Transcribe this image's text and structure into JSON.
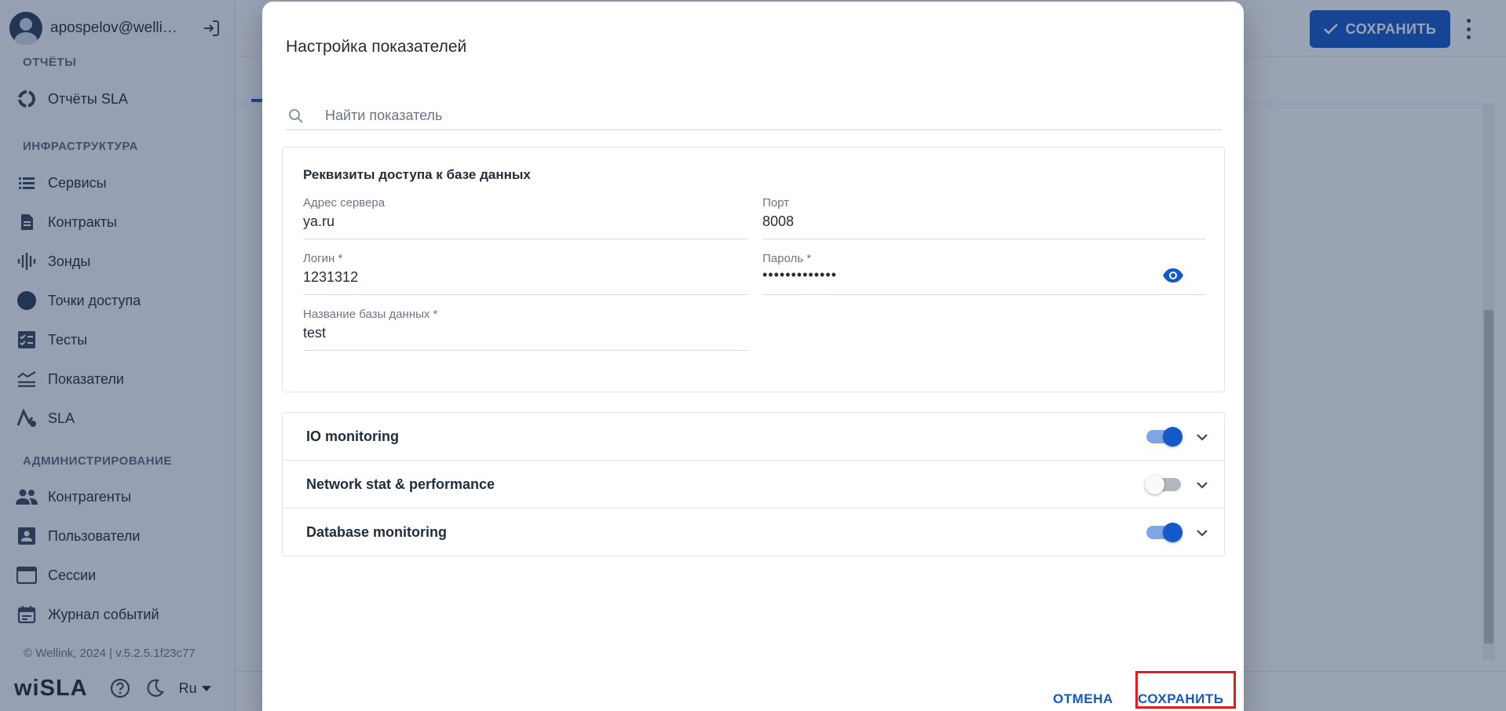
{
  "user": {
    "name": "apospelov@wellin..."
  },
  "sidebar": {
    "sections": {
      "reports": "ОТЧЁТЫ",
      "infrastructure": "ИНФРАСТРУКТУРА",
      "administration": "АДМИНИСТРИРОВАНИЕ"
    },
    "items": [
      {
        "label": "Отчёты SLA",
        "icon": "circle-progress-icon"
      },
      {
        "label": "Сервисы",
        "icon": "list-icon"
      },
      {
        "label": "Контракты",
        "icon": "document-icon"
      },
      {
        "label": "Зонды",
        "icon": "signal-bars-icon"
      },
      {
        "label": "Точки доступа",
        "icon": "filled-circle-icon"
      },
      {
        "label": "Тесты",
        "icon": "checklist-icon"
      },
      {
        "label": "Показатели",
        "icon": "stacked-lines-icon"
      },
      {
        "label": "SLA",
        "icon": "sla-chart-icon"
      },
      {
        "label": "Контрагенты",
        "icon": "people-icon"
      },
      {
        "label": "Пользователи",
        "icon": "user-card-icon"
      },
      {
        "label": "Сессии",
        "icon": "browser-window-icon"
      },
      {
        "label": "Журнал событий",
        "icon": "calendar-icon"
      }
    ],
    "copyright": "© Wellink, 2024 | v.5.2.5.1f23c77",
    "brand": {
      "prefix": "wi",
      "suffix": "SLA"
    },
    "language": "Ru"
  },
  "header": {
    "save_label": "СОХРАНИТЬ"
  },
  "dialog": {
    "title": "Настройка показателей",
    "search": {
      "placeholder": "Найти показатель",
      "value": ""
    },
    "db_card": {
      "title": "Реквизиты доступа к базе данных",
      "fields": {
        "server": {
          "label": "Адрес сервера",
          "value": "ya.ru"
        },
        "port": {
          "label": "Порт",
          "value": "8008"
        },
        "login": {
          "label": "Логин *",
          "value": "1231312"
        },
        "password": {
          "label": "Пароль *",
          "value": "•••••••••••••"
        },
        "db_name": {
          "label": "Название базы данных *",
          "value": "test"
        }
      }
    },
    "metrics": [
      {
        "label": "IO monitoring",
        "enabled": true
      },
      {
        "label": "Network stat & performance",
        "enabled": false
      },
      {
        "label": "Database monitoring",
        "enabled": true
      }
    ],
    "cancel_label": "ОТМЕНА",
    "save_label": "СОХРАНИТЬ"
  },
  "colors": {
    "accent": "#1458c9",
    "highlight": "#e81b1b",
    "overlay": "#192d55"
  }
}
